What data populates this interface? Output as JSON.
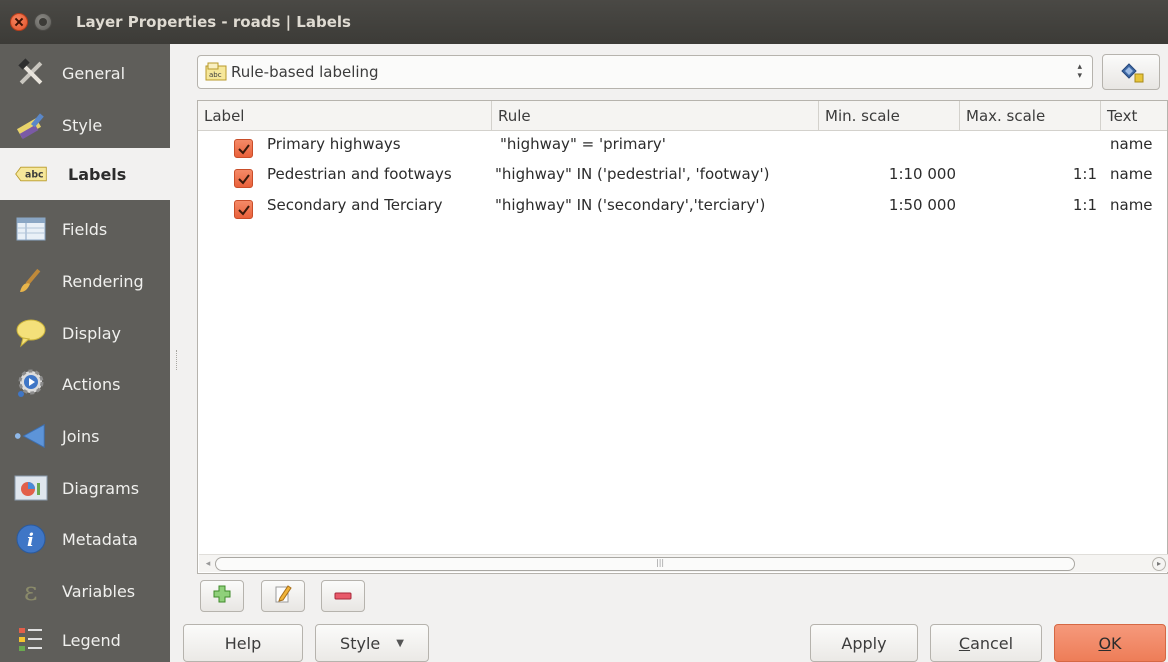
{
  "window": {
    "title": "Layer Properties - roads | Labels"
  },
  "sidebar": {
    "items": [
      {
        "label": "General",
        "icon": "hammer-wrench-icon"
      },
      {
        "label": "Style",
        "icon": "paintbrush-icon"
      },
      {
        "label": "Labels",
        "icon": "abc-label-icon",
        "active": true
      },
      {
        "label": "Fields",
        "icon": "table-fields-icon"
      },
      {
        "label": "Rendering",
        "icon": "paint-brush-icon"
      },
      {
        "label": "Display",
        "icon": "speech-bubble-icon"
      },
      {
        "label": "Actions",
        "icon": "gear-play-icon"
      },
      {
        "label": "Joins",
        "icon": "joins-arrow-icon"
      },
      {
        "label": "Diagrams",
        "icon": "diagram-chart-icon"
      },
      {
        "label": "Metadata",
        "icon": "info-icon"
      },
      {
        "label": "Variables",
        "icon": "epsilon-icon"
      },
      {
        "label": "Legend",
        "icon": "legend-list-icon"
      }
    ]
  },
  "labeling_mode": {
    "selected": "Rule-based labeling",
    "icon": "rule-labeling-icon"
  },
  "style_manager_button": {
    "icon": "style-manager-icon"
  },
  "table": {
    "columns": [
      "Label",
      "Rule",
      "Min. scale",
      "Max. scale",
      "Text"
    ],
    "rows": [
      {
        "checked": true,
        "label": "Primary highways",
        "rule": "\"highway\"  =  'primary'",
        "min_scale": "",
        "max_scale": "",
        "text": "name"
      },
      {
        "checked": true,
        "label": "Pedestrian and footways",
        "rule": "\"highway\" IN ('pedestrial', 'footway')",
        "min_scale": "1:10 000",
        "max_scale": "1:1",
        "text": "name"
      },
      {
        "checked": true,
        "label": "Secondary and Terciary",
        "rule": "\"highway\" IN ('secondary','terciary')",
        "min_scale": "1:50 000",
        "max_scale": "1:1",
        "text": "name"
      }
    ]
  },
  "rule_buttons": [
    {
      "name": "add-rule-button",
      "icon": "plus-icon"
    },
    {
      "name": "edit-rule-button",
      "icon": "edit-pencil-icon"
    },
    {
      "name": "remove-rule-button",
      "icon": "minus-icon"
    }
  ],
  "buttons": {
    "help": "Help",
    "style": "Style",
    "apply": "Apply",
    "cancel_first": "C",
    "cancel_rest": "ancel",
    "ok_first": "O",
    "ok_rest": "K"
  },
  "colors": {
    "accent": "#ee7d58",
    "sidebar_bg": "#5f5e5a",
    "titlebar_bg": "#3c3b37"
  }
}
